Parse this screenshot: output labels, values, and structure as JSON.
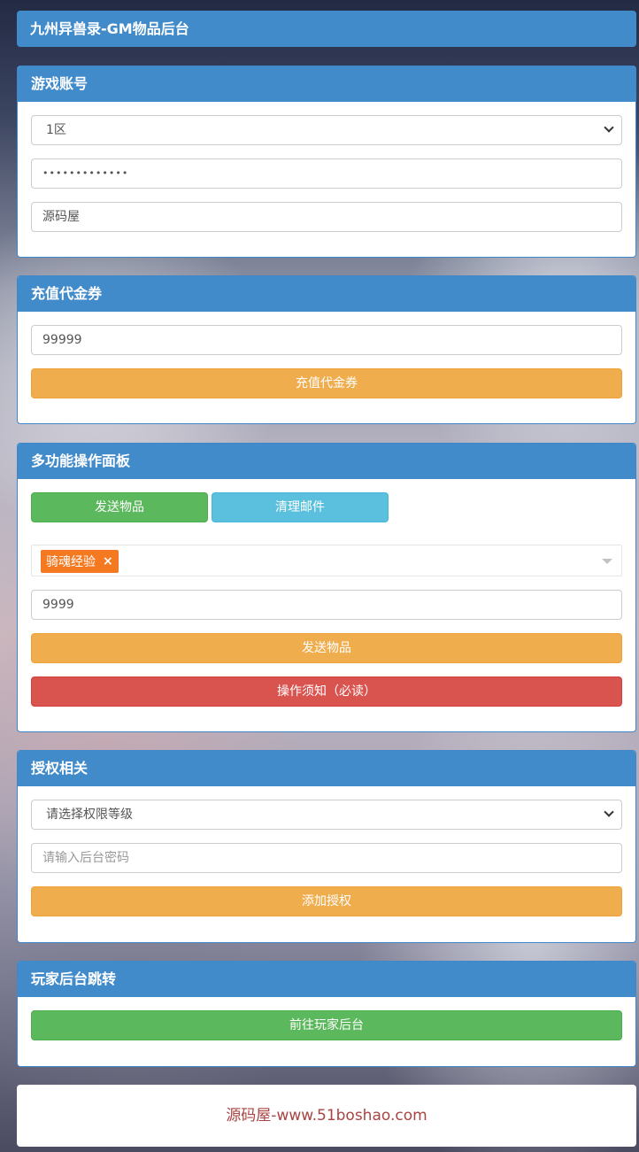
{
  "header": {
    "title": "九州异兽录-GM物品后台"
  },
  "account": {
    "title": "游戏账号",
    "server_value": "1区",
    "password_value": "•••••••••••••",
    "role_value": "源码屋"
  },
  "recharge": {
    "title": "充值代金券",
    "amount_value": "99999",
    "button_label": "充值代金券"
  },
  "multi": {
    "title": "多功能操作面板",
    "tab_send": "发送物品",
    "tab_clear": "清理邮件",
    "selected_item": "骑魂经验",
    "tag_remove": "×",
    "quantity_value": "9999",
    "send_button": "发送物品",
    "notice_button": "操作须知（必读）"
  },
  "auth": {
    "title": "授权相关",
    "level_placeholder": "请选择权限等级",
    "password_placeholder": "请输入后台密码",
    "add_button": "添加授权"
  },
  "jump": {
    "title": "玩家后台跳转",
    "goto_button": "前往玩家后台"
  },
  "footer": {
    "text": "源码屋-www.51boshao.com"
  },
  "colors": {
    "primary": "#428bca",
    "warning": "#f0ad4e",
    "danger": "#d9534f",
    "success": "#5cb85c",
    "info": "#5bc0de",
    "tag": "#f47920",
    "footer_text": "#a94442"
  }
}
